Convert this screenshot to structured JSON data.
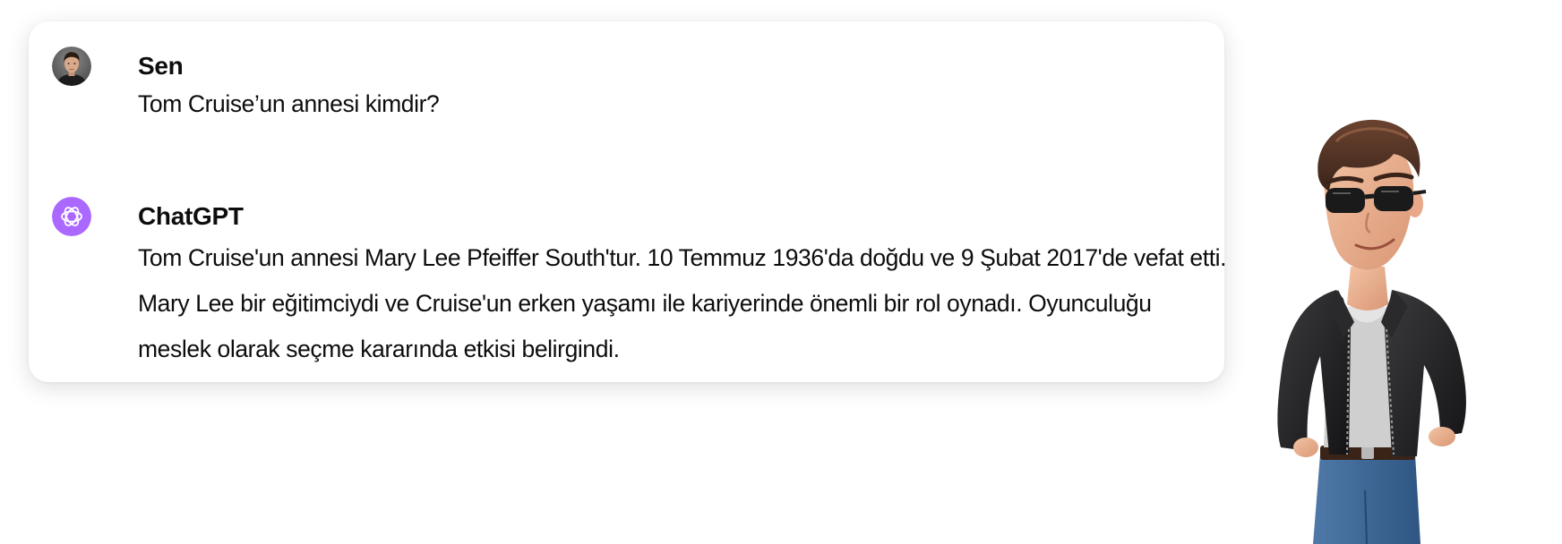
{
  "conversation": {
    "messages": [
      {
        "role": "user",
        "author": "Sen",
        "text": "Tom Cruise’un annesi kimdir?",
        "avatar_icon": "user-photo-avatar"
      },
      {
        "role": "assistant",
        "author": "ChatGPT",
        "text": "Tom Cruise'un annesi Mary Lee Pfeiffer South'tur. 10 Temmuz 1936'da doğdu ve 9 Şubat 2017'de vefat etti. Mary Lee bir eğitimciydi ve Cruise'un erken yaşamı ile kariyerinde önemli bir rol oynadı. Oyunculuğu meslek olarak seçme kararında etkisi belirgindi.",
        "avatar_icon": "openai-logo-icon"
      }
    ]
  },
  "colors": {
    "page_background": "#ffffff",
    "card_background": "#ffffff",
    "text": "#0d0d0d",
    "assistant_avatar": "#ab68ff"
  }
}
